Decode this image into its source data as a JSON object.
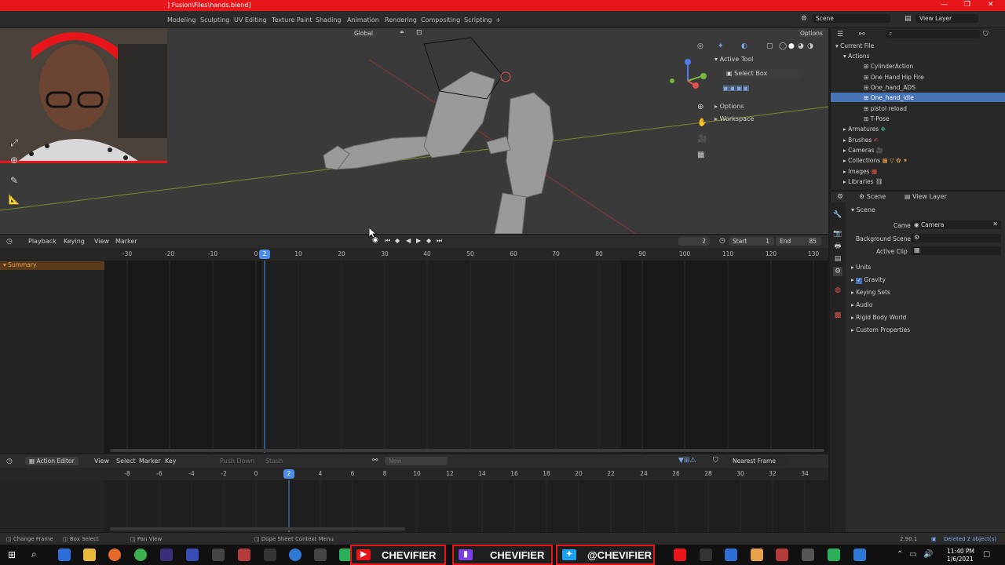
{
  "window": {
    "title": "] Fusion\\Files\\hands.blend]",
    "controls": [
      "—",
      "❐",
      "✕"
    ]
  },
  "menubar": {
    "workspaces": [
      "Modeling",
      "Sculpting",
      "UV Editing",
      "Texture Paint",
      "Shading",
      "Animation",
      "Rendering",
      "Compositing",
      "Scripting",
      "+"
    ],
    "scene": "Scene",
    "view_layer": "View Layer"
  },
  "viewport": {
    "orientation": "Global",
    "options": "Options",
    "n_panel": {
      "active_tool": "Active Tool",
      "select_box": "Select Box",
      "options": "Options",
      "workspace": "Workspace"
    }
  },
  "timeline": {
    "menus": [
      "Playback",
      "Keying",
      "View",
      "Marker"
    ],
    "current_frame": "2",
    "start_label": "Start",
    "start_value": "1",
    "end_label": "End",
    "end_value": "85",
    "ticks": [
      "-30",
      "-20",
      "-10",
      "0",
      "10",
      "20",
      "30",
      "40",
      "50",
      "60",
      "70",
      "80",
      "90",
      "100",
      "110",
      "120",
      "130"
    ],
    "playhead": "2",
    "summary": "Summary"
  },
  "action_editor": {
    "mode": "Action Editor",
    "menus": [
      "View",
      "Select",
      "Marker",
      "Key"
    ],
    "push_down": "Push Down",
    "stash": "Stash",
    "new": "New",
    "snap": "Nearest Frame",
    "ticks": [
      "-8",
      "-6",
      "-4",
      "-2",
      "0",
      "2",
      "4",
      "6",
      "8",
      "10",
      "12",
      "14",
      "16",
      "18",
      "20",
      "22",
      "24",
      "26",
      "28",
      "30",
      "32",
      "34"
    ],
    "playhead": "2"
  },
  "outliner": {
    "root": "Current File",
    "actions_label": "Actions",
    "actions": [
      "CylinderAction",
      "One Hand Hip Fire",
      "One_hand_ADS",
      "One_hand_idle",
      "pistol reload",
      "T-Pose"
    ],
    "selected_action": "One_hand_idle",
    "categories": [
      "Armatures",
      "Brushes",
      "Cameras",
      "Collections",
      "Images",
      "Libraries"
    ]
  },
  "properties": {
    "scene_tab": "Scene",
    "view_layer_tab": "View Layer",
    "panel_title": "Scene",
    "camera_label": "Camera",
    "camera_value": "Camera",
    "background_scene_label": "Background Scene",
    "active_clip_label": "Active Clip",
    "sections": [
      "Units",
      "Gravity",
      "Keying Sets",
      "Audio",
      "Rigid Body World",
      "Custom Properties"
    ],
    "gravity_checked": true
  },
  "status_bar": {
    "change_frame": "Change Frame",
    "box_select": "Box Select",
    "pan_view": "Pan View",
    "context_menu": "Dope Sheet Context Menu",
    "version": "2.90.1",
    "info": "Deleted 2 object(s)"
  },
  "taskbar": {
    "banners": [
      "CHEVIFIER",
      "CHEVIFIER",
      "@CHEVIFIER"
    ],
    "time": "11:40 PM",
    "date": "1/6/2021"
  },
  "colors": {
    "accent_red": "#e8161b",
    "selection_blue": "#4772b3",
    "playhead_blue": "#4f8ee8",
    "summary_orange": "#e8a24b"
  }
}
